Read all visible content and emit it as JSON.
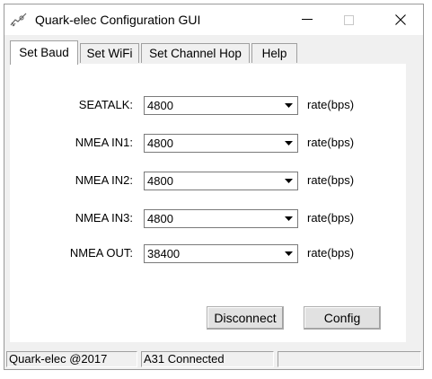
{
  "window": {
    "title": "Quark-elec Configuration GUI"
  },
  "titlebar_buttons": {
    "minimize": "—",
    "maximize": "☐",
    "close": "✕"
  },
  "tabs": [
    {
      "label": "Set Baud",
      "active": true
    },
    {
      "label": "Set WiFi",
      "active": false
    },
    {
      "label": "Set Channel Hop",
      "active": false
    },
    {
      "label": "Help",
      "active": false
    }
  ],
  "baud_rows": [
    {
      "label": "SEATALK:",
      "value": "4800",
      "unit": "rate(bps)"
    },
    {
      "label": "NMEA IN1:",
      "value": "4800",
      "unit": "rate(bps)"
    },
    {
      "label": "NMEA IN2:",
      "value": "4800",
      "unit": "rate(bps)"
    },
    {
      "label": "NMEA IN3:",
      "value": "4800",
      "unit": "rate(bps)"
    },
    {
      "label": "NMEA OUT:",
      "value": "38400",
      "unit": "rate(bps)"
    }
  ],
  "buttons": {
    "disconnect": "Disconnect",
    "config": "Config"
  },
  "statusbar": {
    "pane1": "Quark-elec @2017",
    "pane2": "A31 Connected",
    "pane3": ""
  }
}
